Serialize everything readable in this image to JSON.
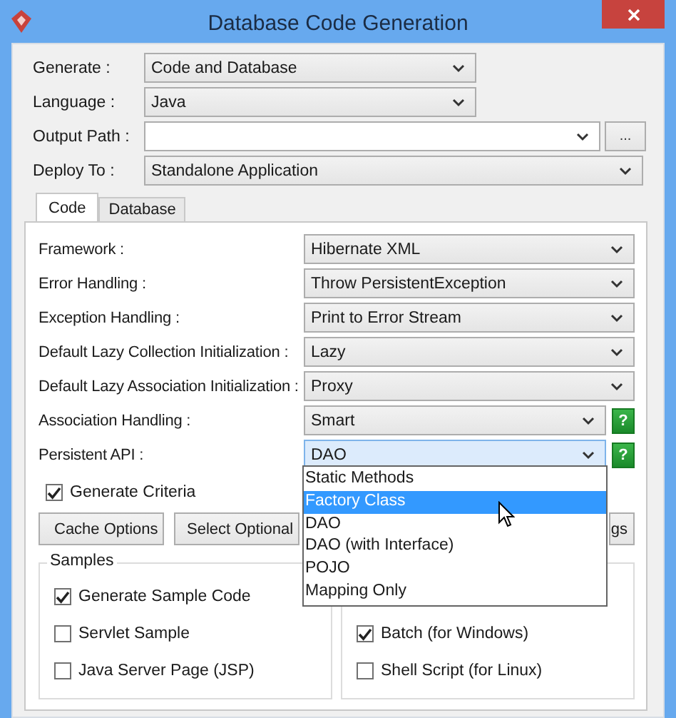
{
  "window": {
    "title": "Database Code Generation"
  },
  "fields": [
    {
      "label": "Generate :",
      "kind": "combo",
      "value": "Code and Database"
    },
    {
      "label": "Language :",
      "kind": "combo",
      "value": "Java"
    },
    {
      "label": "Output Path :",
      "kind": "path",
      "browse": "..."
    },
    {
      "label": "Deploy To :",
      "kind": "wide",
      "value": "Standalone Application"
    }
  ],
  "tabs": [
    {
      "label": "Code",
      "selected": true
    },
    {
      "label": "Database",
      "selected": false
    }
  ],
  "settings": [
    {
      "label": "Framework :",
      "value": "Hibernate XML",
      "open": false
    },
    {
      "label": "Error Handling :",
      "value": "Throw PersistentException",
      "open": false
    },
    {
      "label": "Exception Handling :",
      "value": "Print to Error Stream",
      "open": false
    },
    {
      "label": "Default Lazy Collection Initialization :",
      "value": "Lazy",
      "open": false
    },
    {
      "label": "Default Lazy Association Initialization :",
      "value": "Proxy",
      "open": false
    },
    {
      "label": "Association Handling :",
      "value": "Smart",
      "help": "?",
      "open": false
    },
    {
      "label": "Persistent API :",
      "value": "DAO",
      "help": "?",
      "open": true
    }
  ],
  "dropdown_options": [
    {
      "label": "Static Methods",
      "selected": false
    },
    {
      "label": "Factory Class",
      "selected": true
    },
    {
      "label": "DAO",
      "selected": false
    },
    {
      "label": "DAO (with Interface)",
      "selected": false
    },
    {
      "label": "POJO",
      "selected": false
    },
    {
      "label": "Mapping Only",
      "selected": false
    }
  ],
  "generate_criteria": {
    "label": "Generate Criteria",
    "checked": true
  },
  "buttons": [
    "Cache Options",
    "Select Optional",
    "gs"
  ],
  "samples": {
    "title": "Samples",
    "left": [
      {
        "label": "Generate Sample Code",
        "checked": true
      },
      {
        "label": "Servlet Sample",
        "checked": false
      },
      {
        "label": "Java Server Page (JSP)",
        "checked": false
      }
    ],
    "right": [
      {
        "label": "Batch (for Windows)",
        "checked": true
      },
      {
        "label": "Shell Script (for Linux)",
        "checked": false
      }
    ]
  }
}
